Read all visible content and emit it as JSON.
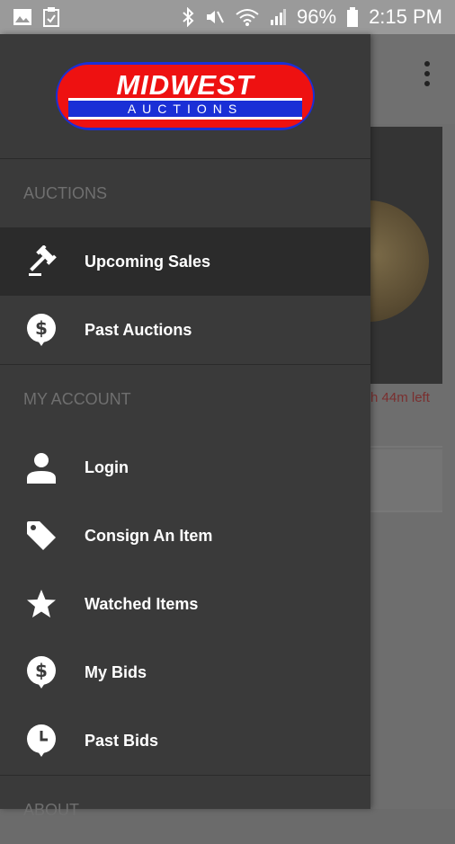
{
  "status_bar": {
    "battery": "96%",
    "time": "2:15 PM"
  },
  "background": {
    "time_left": "h 44m left"
  },
  "logo": {
    "title": "MIDWEST",
    "subtitle": "AUCTIONS"
  },
  "sections": [
    {
      "title": "AUCTIONS",
      "items": [
        {
          "label": "Upcoming Sales",
          "icon": "gavel-icon"
        },
        {
          "label": "Past Auctions",
          "icon": "dollar-bubble-icon"
        }
      ]
    },
    {
      "title": "MY ACCOUNT",
      "items": [
        {
          "label": "Login",
          "icon": "person-icon"
        },
        {
          "label": "Consign An Item",
          "icon": "tag-icon"
        },
        {
          "label": "Watched Items",
          "icon": "star-icon"
        },
        {
          "label": "My Bids",
          "icon": "dollar-bubble-icon"
        },
        {
          "label": "Past Bids",
          "icon": "clock-bubble-icon"
        }
      ]
    },
    {
      "title": "ABOUT",
      "items": []
    }
  ]
}
